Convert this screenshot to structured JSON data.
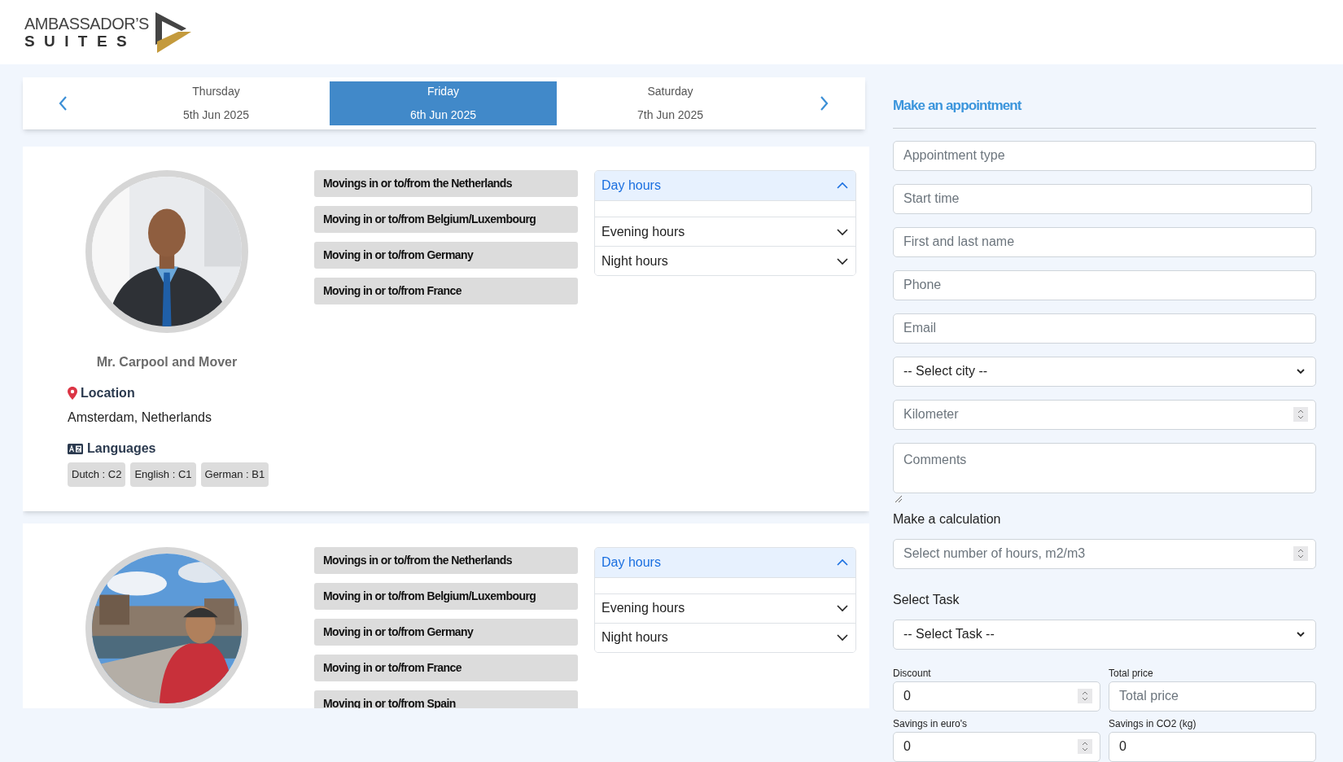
{
  "logo": {
    "line1": "AMBASSADOR’S",
    "line2": "SUITES"
  },
  "date_nav": {
    "days": [
      {
        "weekday": "Thursday",
        "date": "5th Jun 2025",
        "selected": false
      },
      {
        "weekday": "Friday",
        "date": "6th Jun 2025",
        "selected": true
      },
      {
        "weekday": "Saturday",
        "date": "7th Jun 2025",
        "selected": false
      }
    ]
  },
  "providers": [
    {
      "photo": {
        "kind": "picture"
      },
      "name": "Mr. Carpool and Mover",
      "location_label": "Location",
      "location": "Amsterdam, Netherlands",
      "languages_label": "Languages",
      "languages": [
        "Dutch : C2",
        "English : C1",
        "German : B1"
      ],
      "services": [
        "Movings in or to/from the Netherlands",
        "Moving in or to/from Belgium/Luxembourg",
        "Moving in or to/from Germany",
        "Moving in or to/from France"
      ],
      "hours": [
        {
          "label": "Day hours",
          "expanded": true
        },
        {
          "label": "Evening hours",
          "expanded": false
        },
        {
          "label": "Night hours",
          "expanded": false
        }
      ]
    },
    {
      "photo": {
        "kind": "picture"
      },
      "services": [
        "Movings in or to/from the Netherlands",
        "Moving in or to/from Belgium/Luxembourg",
        "Moving in or to/from Germany",
        "Moving in or to/from France",
        "Moving in or to/from Spain"
      ],
      "hours": [
        {
          "label": "Day hours",
          "expanded": true
        },
        {
          "label": "Evening hours",
          "expanded": false
        },
        {
          "label": "Night hours",
          "expanded": false
        }
      ]
    }
  ],
  "appointment": {
    "title": "Make an appointment",
    "fields": [
      {
        "kind": "text",
        "placeholder": "Appointment type"
      },
      {
        "kind": "text",
        "placeholder": "Start time"
      },
      {
        "kind": "text",
        "placeholder": "First and last name"
      },
      {
        "kind": "text",
        "placeholder": "Phone"
      },
      {
        "kind": "text",
        "placeholder": "Email"
      },
      {
        "kind": "select",
        "value": "-- Select city --"
      },
      {
        "kind": "number",
        "placeholder": "Kilometer"
      },
      {
        "kind": "textarea",
        "placeholder": "Comments"
      }
    ]
  },
  "calculation": {
    "title": "Make a calculation",
    "amount": {
      "placeholder": "Select number of hours, m2/m3"
    },
    "task_label": "Select Task",
    "task_select": {
      "value": "-- Select Task --"
    },
    "fields": [
      {
        "label": "Discount",
        "kind": "number",
        "value": "0"
      },
      {
        "label": "Total price",
        "kind": "text",
        "placeholder": "Total price"
      },
      {
        "label": "Savings in euro's",
        "kind": "number",
        "value": "0"
      },
      {
        "label": "Savings in CO2 (kg)",
        "kind": "text",
        "value": "0"
      }
    ]
  }
}
